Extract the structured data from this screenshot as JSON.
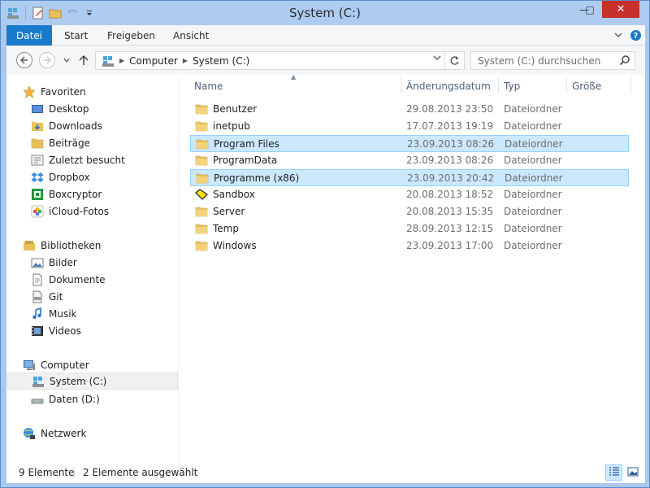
{
  "window": {
    "title": "System (C:)",
    "minimize_glyph": "—",
    "maximize_glyph": "□",
    "close_glyph": "✕"
  },
  "ribbon": {
    "tabs": [
      {
        "label": "Datei",
        "active": true
      },
      {
        "label": "Start"
      },
      {
        "label": "Freigeben"
      },
      {
        "label": "Ansicht"
      }
    ]
  },
  "address": {
    "segments": [
      "Computer",
      "System (C:)"
    ]
  },
  "search": {
    "placeholder": "System (C:) durchsuchen"
  },
  "navigation": {
    "favorites": {
      "header": "Favoriten",
      "items": [
        "Desktop",
        "Downloads",
        "Beiträge",
        "Zuletzt besucht",
        "Dropbox",
        "Boxcryptor",
        "iCloud-Fotos"
      ]
    },
    "libraries": {
      "header": "Bibliotheken",
      "items": [
        "Bilder",
        "Dokumente",
        "Git",
        "Musik",
        "Videos"
      ]
    },
    "computer": {
      "header": "Computer",
      "items": [
        "System (C:)",
        "Daten (D:)"
      ],
      "selected": "System (C:)"
    },
    "network": {
      "header": "Netzwerk"
    }
  },
  "columns": {
    "name": "Name",
    "date": "Änderungsdatum",
    "type": "Typ",
    "size": "Größe"
  },
  "files": [
    {
      "name": "Benutzer",
      "date": "29.08.2013 23:50",
      "type": "Dateiordner",
      "selected": false,
      "icon": "folder"
    },
    {
      "name": "inetpub",
      "date": "17.07.2013 19:19",
      "type": "Dateiordner",
      "selected": false,
      "icon": "folder"
    },
    {
      "name": "Program Files",
      "date": "23.09.2013 08:26",
      "type": "Dateiordner",
      "selected": true,
      "icon": "folder"
    },
    {
      "name": "ProgramData",
      "date": "23.09.2013 08:26",
      "type": "Dateiordner",
      "selected": false,
      "icon": "folder"
    },
    {
      "name": "Programme (x86)",
      "date": "23.09.2013 20:42",
      "type": "Dateiordner",
      "selected": true,
      "icon": "folder"
    },
    {
      "name": "Sandbox",
      "date": "20.08.2013 18:52",
      "type": "Dateiordner",
      "selected": false,
      "icon": "sandbox"
    },
    {
      "name": "Server",
      "date": "20.08.2013 15:35",
      "type": "Dateiordner",
      "selected": false,
      "icon": "folder"
    },
    {
      "name": "Temp",
      "date": "28.09.2013 12:15",
      "type": "Dateiordner",
      "selected": false,
      "icon": "folder"
    },
    {
      "name": "Windows",
      "date": "23.09.2013 17:00",
      "type": "Dateiordner",
      "selected": false,
      "icon": "folder"
    }
  ],
  "status": {
    "count": "9 Elemente",
    "selection": "2 Elemente ausgewählt"
  },
  "colors": {
    "accent": "#1979ca",
    "selection_bg": "#cce8ff",
    "selection_border": "#99d1ff",
    "close_button": "#c7302b",
    "folder": "#e8c15a"
  }
}
